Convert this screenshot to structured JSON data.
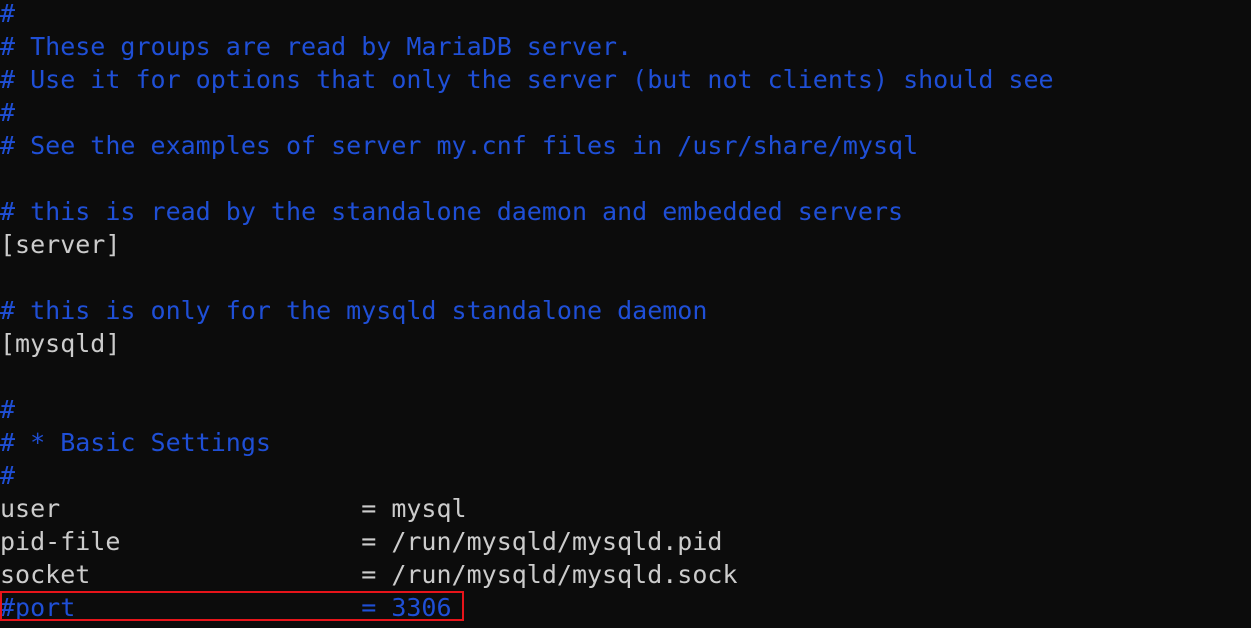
{
  "editor": {
    "lines": [
      {
        "text": "#",
        "kind": "comment"
      },
      {
        "text": "# These groups are read by MariaDB server.",
        "kind": "comment"
      },
      {
        "text": "# Use it for options that only the server (but not clients) should see",
        "kind": "comment"
      },
      {
        "text": "#",
        "kind": "comment"
      },
      {
        "text": "# See the examples of server my.cnf files in /usr/share/mysql",
        "kind": "comment"
      },
      {
        "text": "",
        "kind": "blank"
      },
      {
        "text": "# this is read by the standalone daemon and embedded servers",
        "kind": "comment"
      },
      {
        "text": "[server]",
        "kind": "plain"
      },
      {
        "text": "",
        "kind": "blank"
      },
      {
        "text": "# this is only for the mysqld standalone daemon",
        "kind": "comment"
      },
      {
        "text": "[mysqld]",
        "kind": "plain"
      },
      {
        "text": "",
        "kind": "blank"
      },
      {
        "text": "#",
        "kind": "comment"
      },
      {
        "text": "# * Basic Settings",
        "kind": "comment"
      },
      {
        "text": "#",
        "kind": "comment"
      },
      {
        "text": "user                    = mysql",
        "kind": "plain"
      },
      {
        "text": "pid-file                = /run/mysqld/mysqld.pid",
        "kind": "plain"
      },
      {
        "text": "socket                  = /run/mysqld/mysqld.sock",
        "kind": "plain"
      },
      {
        "text": "#port                   = 3306",
        "kind": "comment"
      }
    ],
    "colors": {
      "background": "#0c0c0c",
      "comment": "#1f4fd6",
      "plain": "#cccccc",
      "highlight_border": "#e8141a"
    }
  }
}
